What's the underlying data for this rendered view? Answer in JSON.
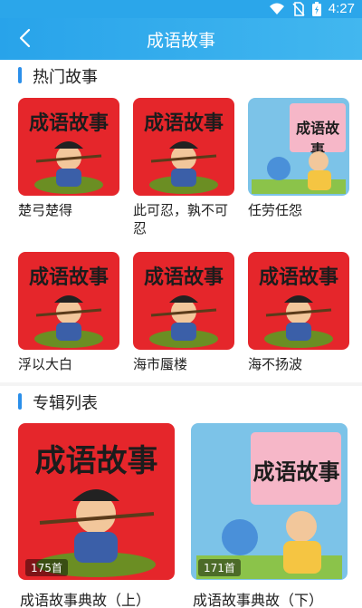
{
  "status": {
    "time": "4:27"
  },
  "header": {
    "title": "成语故事"
  },
  "hot": {
    "title": "热门故事",
    "items": [
      {
        "title": "楚弓楚得",
        "cover": "red",
        "cover_text": "成语故事"
      },
      {
        "title": "此可忍，孰不可忍",
        "cover": "red",
        "cover_text": "成语故事"
      },
      {
        "title": "任劳任怨",
        "cover": "blue",
        "cover_text": "成语故事"
      },
      {
        "title": "浮以大白",
        "cover": "red",
        "cover_text": "成语故事"
      },
      {
        "title": "海市蜃楼",
        "cover": "red",
        "cover_text": "成语故事"
      },
      {
        "title": "海不扬波",
        "cover": "red",
        "cover_text": "成语故事"
      }
    ]
  },
  "albums": {
    "title": "专辑列表",
    "items": [
      {
        "title": "成语故事典故（上）",
        "count": "175首",
        "cover": "red",
        "cover_text": "成语故事"
      },
      {
        "title": "成语故事典故（下）",
        "count": "171首",
        "cover": "blue",
        "cover_text": "成语故事"
      }
    ]
  },
  "colors": {
    "header": "#2ba6ea",
    "accent": "#2b8fea",
    "cover_red": "#e5262b"
  }
}
